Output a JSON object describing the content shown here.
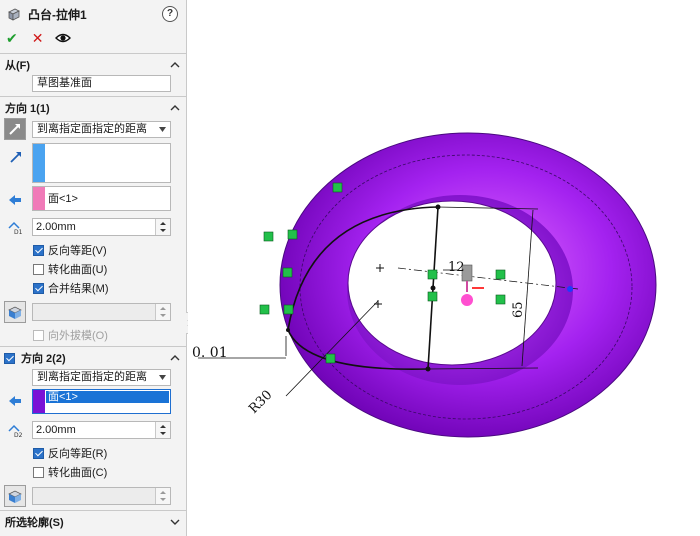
{
  "panel": {
    "title": "凸台-拉伸1",
    "help": "?",
    "actions": {
      "ok": "✔",
      "cancel": "✕",
      "preview": "👁"
    },
    "from": {
      "header": "从(F)",
      "value": "草图基准面"
    },
    "direction1": {
      "header": "方向 1(1)",
      "end_condition": "到离指定面指定的距离",
      "face_selection": "面<1>",
      "distance": "2.00mm",
      "reverse_offset": {
        "label": "反向等距(V)",
        "checked": true
      },
      "translate_surface": {
        "label": "转化曲面(U)",
        "checked": false
      },
      "merge_result": {
        "label": "合并结果(M)",
        "checked": true
      },
      "draft_outward": {
        "label": "向外拔模(O)",
        "checked": false
      }
    },
    "direction2": {
      "header": "方向 2(2)",
      "enabled": true,
      "end_condition": "到离指定面指定的距离",
      "face_selection": "面<1>",
      "distance": "2.00mm",
      "reverse_offset": {
        "label": "反向等距(R)",
        "checked": true
      },
      "translate_surface": {
        "label": "转化曲面(C)",
        "checked": false
      }
    },
    "contours": {
      "header": "所选轮廓(S)"
    }
  },
  "viewport": {
    "dimensions": {
      "offset": "0. 01",
      "radius": "R30",
      "height": "65",
      "small": "12"
    },
    "colors": {
      "torus": "#a020f0",
      "torus_dark": "#6a00b0",
      "sketch": "#111111",
      "relation": "#22c04a"
    }
  }
}
